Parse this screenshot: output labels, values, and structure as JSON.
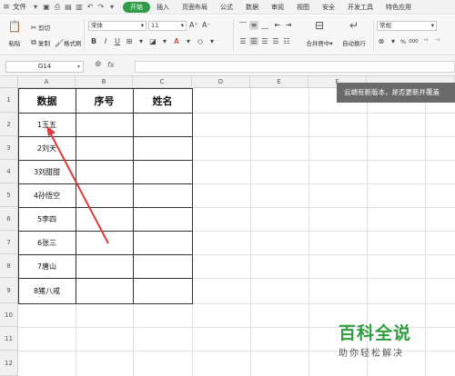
{
  "menubar": {
    "file_label": "文件",
    "tabs": [
      {
        "label": "开始",
        "active": true
      },
      {
        "label": "插入",
        "active": false
      },
      {
        "label": "页面布局",
        "active": false
      },
      {
        "label": "公式",
        "active": false
      },
      {
        "label": "数据",
        "active": false
      },
      {
        "label": "审阅",
        "active": false
      },
      {
        "label": "视图",
        "active": false
      },
      {
        "label": "安全",
        "active": false
      },
      {
        "label": "开发工具",
        "active": false
      },
      {
        "label": "特色应用",
        "active": false
      }
    ]
  },
  "ribbon": {
    "paste_label": "粘贴",
    "cut_label": "剪切",
    "copy_label": "复制",
    "format_painter_label": "格式刷",
    "font_name": "宋体",
    "font_size": "11",
    "merge_label": "合并居中",
    "wrap_label": "自动换行",
    "number_format": "常规",
    "percent_symbol": "%",
    "thousands_symbol": "000"
  },
  "formula_bar": {
    "name_box": "G14",
    "fx_label": "fx"
  },
  "columns": [
    "A",
    "B",
    "C",
    "D",
    "E",
    "F"
  ],
  "rows": [
    "1",
    "2",
    "3",
    "4",
    "5",
    "6",
    "7",
    "8",
    "9",
    "10",
    "11",
    "12"
  ],
  "table": {
    "headers": [
      "数据",
      "序号",
      "姓名"
    ],
    "data_a": [
      "1王五",
      "2刘天",
      "3刘甜甜",
      "4孙悟空",
      "5李四",
      "6张三",
      "7唐山",
      "8猪八戒"
    ]
  },
  "toast": "云端有新版本，是否更新并覆盖",
  "watermark": {
    "title": "百科全说",
    "subtitle": "助你轻松解决"
  },
  "colors": {
    "accent_green": "#2e9c48",
    "arrow_red": "#e03b3b"
  }
}
